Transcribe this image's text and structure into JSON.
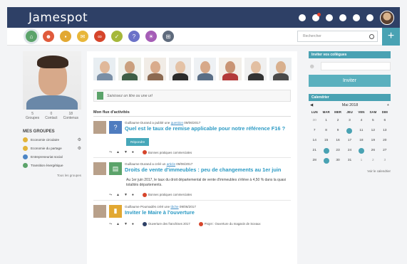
{
  "topbar": {
    "brand": "Jamespot",
    "icons": [
      "globe-icon",
      "notification-icon",
      "help-icon",
      "clock-icon",
      "settings-icon",
      "dashboard-icon"
    ],
    "badge_color": "#e4412b"
  },
  "nav": {
    "circles": [
      {
        "name": "home-icon",
        "color": "#5ba36a",
        "glyph": "⌂"
      },
      {
        "name": "users-icon",
        "color": "#e05b3c",
        "glyph": "☻"
      },
      {
        "name": "folder-icon",
        "color": "#e2a832",
        "glyph": "▪"
      },
      {
        "name": "mail-icon",
        "color": "#e8b73a",
        "glyph": "✉"
      },
      {
        "name": "link-icon",
        "color": "#d6452b",
        "glyph": "∞"
      },
      {
        "name": "check-icon",
        "color": "#a6b83a",
        "glyph": "✓"
      },
      {
        "name": "help-icon",
        "color": "#6b72c8",
        "glyph": "?"
      },
      {
        "name": "bulb-icon",
        "color": "#a55db6",
        "glyph": "☀"
      },
      {
        "name": "apps-icon",
        "color": "#5f6b7d",
        "glyph": "⊞"
      }
    ],
    "search_placeholder": "Rechercher",
    "plus_label": "+"
  },
  "profile": {
    "stats": [
      {
        "value": "5",
        "label": "Groupes"
      },
      {
        "value": "0",
        "label": "Contact"
      },
      {
        "value": "18",
        "label": "Contenus"
      }
    ],
    "groups_title": "MES GROUPES",
    "groups": [
      {
        "label": "Economie circulaire",
        "color": "#e2b43a"
      },
      {
        "label": "Economie du partage",
        "color": "#e2b43a"
      },
      {
        "label": "Entrepreneuriat social",
        "color": "#4c85c5"
      },
      {
        "label": "Transition énergétique",
        "color": "#5ba36a"
      }
    ],
    "all_groups": "Tous les groupes"
  },
  "feed": {
    "post_placeholder": "Saisissez un titre ou une url",
    "title": "Mon flux d'activités",
    "items": [
      {
        "author_pre": "Guillaume Durand a publié une",
        "link": "question",
        "date": "09/06/2017",
        "title": "Quel est le taux de remise applicable pour notre référence F16 ?",
        "type_glyph": "?",
        "type_color": "#4f7cbf",
        "button": "Répondre",
        "tag": "Bonnes pratiques commerciales",
        "tag_color": "#d6452b"
      },
      {
        "author_pre": "Guillaume Durand a créé un",
        "link": "article",
        "date": "09/06/2017",
        "title": "Droits de vente d'immeubles : peu de changements au 1er juin",
        "type_glyph": "▤",
        "type_color": "#5ba36a",
        "body": "Au 1er juin 2017, le taux du droit départemental de vente d'immeubles s'élève à 4,50 % dans la quasi totalités départements.",
        "tag": "Bonnes pratiques commerciales",
        "tag_color": "#d6452b"
      },
      {
        "author_pre": "Guillaume Poumadès créé une",
        "link": "tâche",
        "date": "09/06/2017",
        "title": "Inviter le Maire à l'ouverture",
        "type_glyph": "▮",
        "type_color": "#e2a832",
        "tag": "Ouverture des franchises 2017",
        "tag_color": "#2e4066",
        "tag2": "Projet : Ouverture du magasin de Sceaux",
        "tag2_color": "#d6452b"
      }
    ]
  },
  "invite": {
    "title": "Inviter vos collègues",
    "button": "Inviter"
  },
  "calendar": {
    "title": "Calendrier",
    "month": "Mai 2018",
    "prev": "◀",
    "next": "+",
    "day_names": [
      "LUN",
      "MAR",
      "MER",
      "JEU",
      "VEN",
      "SAM",
      "DIM"
    ],
    "weeks": [
      [
        "30",
        "1",
        "2",
        "3",
        "4",
        "5",
        "6"
      ],
      [
        "7",
        "8",
        "9",
        "10",
        "11",
        "12",
        "13"
      ],
      [
        "14",
        "15",
        "16",
        "17",
        "18",
        "19",
        "20"
      ],
      [
        "21",
        "22",
        "23",
        "24",
        "25",
        "26",
        "27"
      ],
      [
        "28",
        "29",
        "30",
        "31",
        "1",
        "2",
        "3"
      ]
    ],
    "marked_color": "#49a2b3",
    "see_calendar": "Voir le calendrier"
  }
}
